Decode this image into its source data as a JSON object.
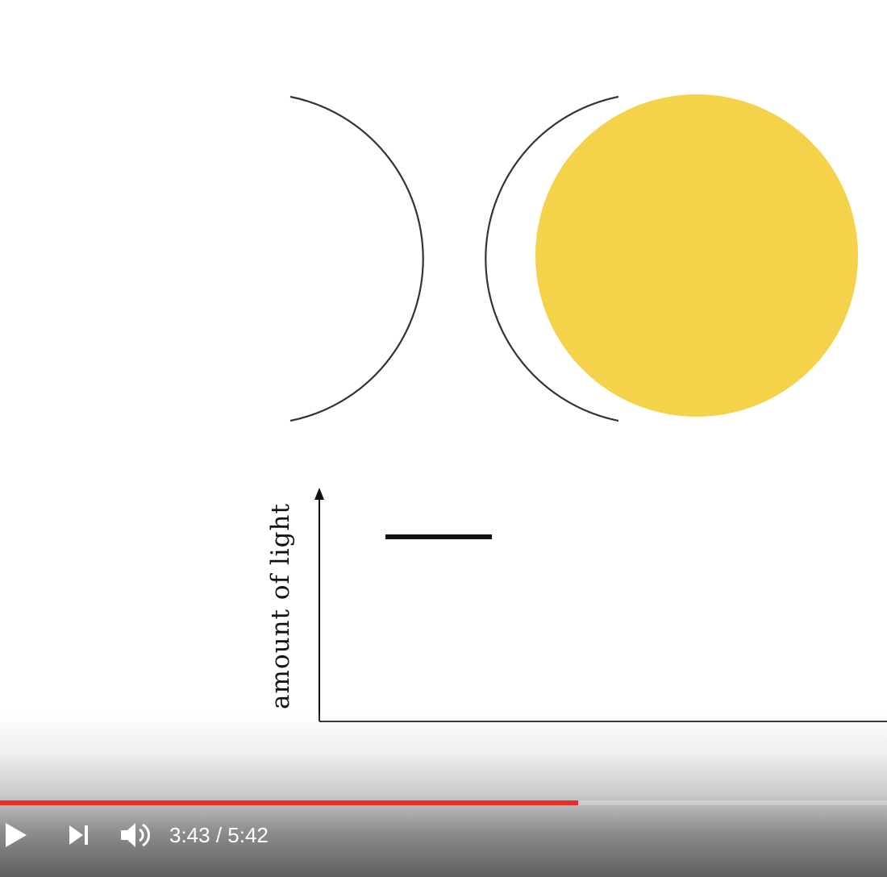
{
  "video": {
    "axis_label": "amount of light",
    "sun_color": "#f4d24a"
  },
  "player": {
    "progress_fraction": 0.652,
    "progress_color": "#e8302a",
    "current_time": "3:43",
    "separator": " / ",
    "duration": "5:42",
    "icons": {
      "play": "play-icon",
      "next": "next-icon",
      "volume": "volume-icon"
    }
  }
}
